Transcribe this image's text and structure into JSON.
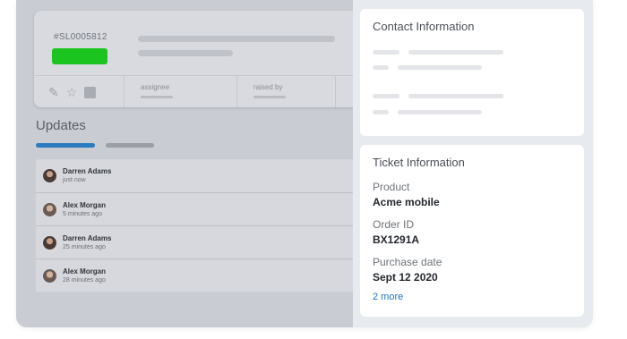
{
  "ticket": {
    "id": "#SL0005812",
    "status_color": "#1bc41f",
    "meta": {
      "assignee_label": "assignee",
      "raised_by_label": "raised by"
    },
    "icons": [
      "pin-icon",
      "star-icon",
      "square-icon"
    ]
  },
  "updates": {
    "title": "Updates",
    "items": [
      {
        "name": "Darren Adams",
        "time": "just now"
      },
      {
        "name": "Alex Morgan",
        "time": "5 minutes ago"
      },
      {
        "name": "Darren Adams",
        "time": "25 minutes ago"
      },
      {
        "name": "Alex Morgan",
        "time": "28 minutes ago"
      }
    ]
  },
  "contact": {
    "title": "Contact Information"
  },
  "ticket_info": {
    "title": "Ticket Information",
    "fields": [
      {
        "label": "Product",
        "value": "Acme mobile"
      },
      {
        "label": "Order ID",
        "value": "BX1291A"
      },
      {
        "label": "Purchase date",
        "value": "Sept 12 2020"
      }
    ],
    "more_link": "2 more"
  },
  "colors": {
    "accent": "#2a7bbf",
    "link": "#1f72c2",
    "status": "#1bc41f"
  }
}
